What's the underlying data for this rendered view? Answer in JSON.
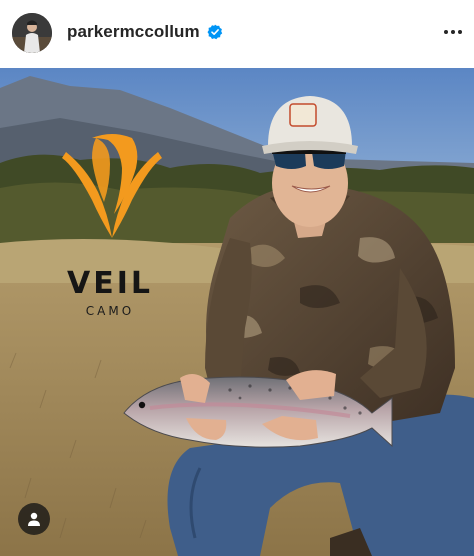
{
  "post": {
    "username": "parkermccollum",
    "verified": true,
    "more_icon": "more-horizontal-icon",
    "tag_icon": "person-tag-icon"
  },
  "overlay": {
    "brand_name": "VEIL",
    "brand_sub": "CAMO",
    "brand_color": "#f39a1e"
  },
  "colors": {
    "verified_blue": "#0095f6",
    "text": "#262626"
  }
}
